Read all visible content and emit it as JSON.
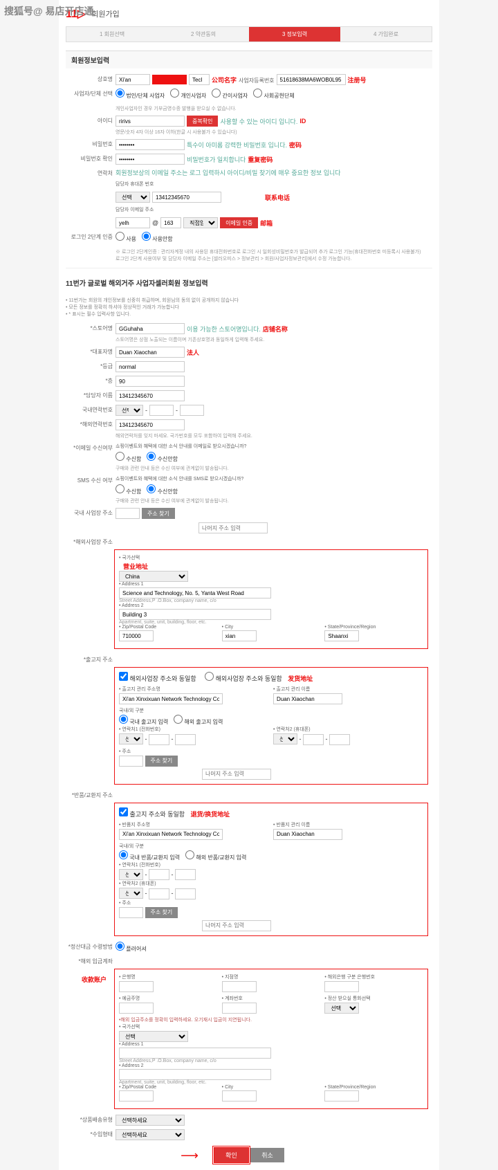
{
  "watermark": "搜狐号@ 易店开店通",
  "logo": "11▷",
  "logo_sub": "회원가입",
  "steps": [
    "1 회원선택",
    "2 약관동의",
    "3 정보입력",
    "4 가입완료"
  ],
  "sec1_title": "회원정보입력",
  "company": {
    "lbl": "상호명",
    "val1": "Xi'an",
    "val2": "Tecl",
    "ann": "公司名字"
  },
  "bizno": {
    "lbl": "사업자등록번호",
    "val": "51618638MA6WOB0L95",
    "ann": "注册号"
  },
  "biztype": {
    "lbl": "사업자/단체 선택",
    "opts": [
      "법인/단체 사업자",
      "개인사업자",
      "간이사업자",
      "사회공헌단체"
    ],
    "note": "개인사업자인 경우 기부금영수증 발행을 받으실 수 없습니다."
  },
  "userid": {
    "lbl": "아이디",
    "val": "ririvs",
    "btn": "중복확인",
    "note": "사용할 수 있는 아이디 입니다.",
    "ann": "ID",
    "note2": "영문/숫자 4자 이상 16자 이하(한글 시 사용불가 수 있습니다)"
  },
  "pw": {
    "lbl": "비밀번호",
    "note": "특수이 아미롬 강력한 비밀번호 입니다.",
    "ann": "密码"
  },
  "pw2": {
    "lbl": "비밀번호 확인",
    "note": "비밀번호가 일치합니다",
    "ann": "重复密码"
  },
  "contact": {
    "lbl": "연락처",
    "note": "회원정보상의 이메일 주소는 로그 입력하시 아이디/비밀 찾기에 매우 중요한 정보 입니다"
  },
  "phone": {
    "lbl": "담당자 휴대폰 번호",
    "sel": "선택",
    "val": "13412345670",
    "ann": "联系电话"
  },
  "email": {
    "lbl": "담당자 이메일 주소",
    "v1": "yelh",
    "v2": "163",
    "sel": "직접입력",
    "btn": "이메일 인증",
    "ann": "邮箱"
  },
  "login2": {
    "lbl": "로그인 2단계 인증",
    "opts": [
      "사용",
      "사용안함"
    ],
    "note": "※ 로그인 2단계인증 : 관리자계정 내의 사용된 휴대전화번호로 로그인 시 일회성비밀번호가 발급되어 추가 로그인 기능(휴대전화번호 미등록시 사용불가)\n로그인 2단계 사용여부 및 담당자 이메일 주소는 [셀러오피스 > 정보관리 > 회원/사업자정보관리]에서 수정 가능합니다."
  },
  "sec2_title": "11번가 글로벌 해외거주 사업자셀러회원 정보입력",
  "sec2_note": [
    "• 11번가는 회원의 개인정보를 신중히 취급하며, 회원님의 동의 없이 공개하지 않습니다",
    "• 모든 정보를 정확히 하셔야 정상적인 거래가 가능합니다",
    "• * 표시는 필수 입력사항 입니다."
  ],
  "store": {
    "lbl": "*스토어명",
    "val": "GGuhaha",
    "note": "이용 가능한 스토어명입니다.",
    "ann": "店铺名称",
    "note2": "스토어명은 상점 노출되는 이름이며 기존상호명과 동일하게 입력해 주세요."
  },
  "ceo": {
    "lbl": "*대표자명",
    "val": "Duan Xiaochan",
    "ann": "法人"
  },
  "grade": {
    "lbl": "*등급",
    "val": "normal"
  },
  "floor": {
    "lbl": "*층",
    "val": "90"
  },
  "mgrname": {
    "lbl": "*담당자 이름",
    "val": "13412345670"
  },
  "domphone": {
    "lbl": "국내연락번호",
    "sel": "선택"
  },
  "intlphone": {
    "lbl": "*해외연락번호",
    "val": "13412345670",
    "note": "해외연락처를 잊지 마세요. 국가번호를 모두 포함하여 입력해 주세요."
  },
  "emailrecv": {
    "lbl": "*이메일 수신여부",
    "q": "쇼핑이벤트와 혜택에 대한 소식 안내를 이메일로 받으시겠습니까?",
    "opts": [
      "수신함",
      "수신안함"
    ],
    "note": "구매와 관련 안내 등은 수신 여부에 관계없이 발송됩니다."
  },
  "smsrecv": {
    "lbl": "SMS 수신 여부",
    "q": "쇼핑이벤트와 혜택에 대한 소식 안내를 SMS로 받으시겠습니까?",
    "opts": [
      "수신함",
      "수신안함"
    ],
    "note": "구매와 관련 안내 등은 수신 여부에 관계없이 발송됩니다."
  },
  "domaddr": {
    "lbl": "국내 사업장 주소",
    "btn": "주소 찾기",
    "ph": "나머지 주소 입력"
  },
  "bizaddr": {
    "lbl": "*해외사업장 주소",
    "ann": "营业地址",
    "country_lbl": "• 국가선택",
    "country": "China",
    "a1_lbl": "• Address 1",
    "a1": "Science and Technology, No. 5, Yanta West Road",
    "a1_note": "Street Address,P .O.Box, company name, c/o",
    "a2_lbl": "• Address 2",
    "a2": "Building 3",
    "a2_note": "Apartment, suite, unit, building, floor, etc.",
    "zip_lbl": "• Zip/Postal Code",
    "zip": "710000",
    "city_lbl": "• City",
    "city": "xian",
    "state_lbl": "• State/Province/Region",
    "state": "Shaanxi"
  },
  "ship": {
    "lbl": "*출고지 주소",
    "chk1": "해외사업장 주소와 동일함",
    "chk2": "해외사업장 주소와 동일함",
    "ann": "发货地址",
    "mgr_lbl": "• 출고지 관리 주소명",
    "mgr": "Xi'an Xinxixuan Network Technology Co.",
    "name_lbl": "• 출고지 관리 이름",
    "name": "Duan Xiaochan",
    "region_lbl": "국내/외 구분",
    "region_opts": [
      "국내 출고지 입력",
      "해외 출고지 입력"
    ],
    "ph1_lbl": "• 연락처1 (전화번호)",
    "ph2_lbl": "• 연락처2 (휴대폰)",
    "sel": "선택",
    "addr_lbl": "• 주소",
    "btn": "주소 찾기",
    "ph": "나머지 주소 입력"
  },
  "return": {
    "lbl": "*반품/교환지 주소",
    "chk": "출고지 주소와 동일함",
    "ann": "退货/换货地址",
    "mgr_lbl": "• 반품지 주소명",
    "mgr": "Xi'an Xinxixuan Network Technology Co.",
    "name_lbl": "• 반품지 관리 이름",
    "name": "Duan Xiaochan",
    "region_lbl": "국내/외 구분",
    "region_opts": [
      "국내 반품/교환지 입력",
      "해외 반품/교환지 입력"
    ],
    "ph1_lbl": "• 연락처1 (전화번호)",
    "ph2_lbl": "• 연락처2 (휴대폰)",
    "sel": "선택",
    "addr_lbl": "• 주소",
    "btn": "주소 찾기",
    "ph": "나머지 주소 입력"
  },
  "calcmethod": {
    "lbl": "*정산대금 수령방법",
    "opt": "플러어셔"
  },
  "bank": {
    "lbl": "*해외 입금계좌",
    "ann": "收款账户",
    "bank_lbl": "• 은행명",
    "branch_lbl": "• 지점명",
    "route_lbl": "• 해외은행 구분 은행번호",
    "acctname_lbl": "• 예금주명",
    "acct_lbl": "• 계좌번호",
    "fcurr_lbl": "• 정산 받으실 통화선택",
    "fcurr": "선택",
    "note": "•해외 입금주소를 정확히 입력하세요. 오기재시 입금이 지연됩니다.",
    "country_lbl": "• 국가선택",
    "country": "선택",
    "a1_lbl": "• Address 1",
    "a1_note": "Street Address,P .O.Box, company name, c/o",
    "a2_lbl": "• Address 2",
    "a2_note": "Apartment, suite, unit, building, floor, etc.",
    "zip_lbl": "• Zip/Postal Code",
    "city_lbl": "• City",
    "state_lbl": "• State/Province/Region"
  },
  "shipcat": {
    "lbl": "*상품배송유형",
    "val": "선택하세요"
  },
  "import": {
    "lbl": "*수입형태",
    "val": "선택하세요"
  },
  "confirm": "확인",
  "cancel": "취소"
}
